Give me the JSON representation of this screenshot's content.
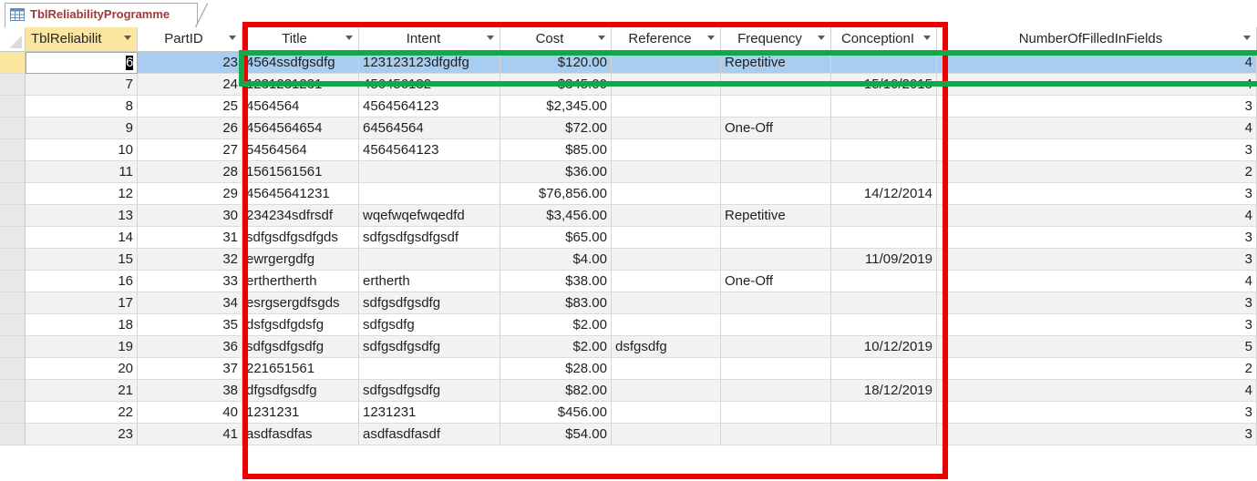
{
  "tab": {
    "title": "TblReliabilityProgramme",
    "icon": "table-icon"
  },
  "columns": [
    {
      "label": "TblReliabilit",
      "align": "right"
    },
    {
      "label": "PartID",
      "align": "right"
    },
    {
      "label": "Title",
      "align": "left"
    },
    {
      "label": "Intent",
      "align": "left"
    },
    {
      "label": "Cost",
      "align": "right"
    },
    {
      "label": "Reference",
      "align": "left"
    },
    {
      "label": "Frequency",
      "align": "left"
    },
    {
      "label": "ConceptionI",
      "align": "right"
    },
    {
      "label": "NumberOfFilledInFields",
      "align": "right"
    }
  ],
  "rows": [
    [
      "6",
      "23",
      "4564ssdfgsdfg",
      "123123123dfgdfg",
      "$120.00",
      "",
      "Repetitive",
      "",
      "4"
    ],
    [
      "7",
      "24",
      "1231231231",
      "456456132",
      "$345.00",
      "",
      "",
      "15/10/2015",
      "4"
    ],
    [
      "8",
      "25",
      "4564564",
      "4564564123",
      "$2,345.00",
      "",
      "",
      "",
      "3"
    ],
    [
      "9",
      "26",
      "4564564654",
      "64564564",
      "$72.00",
      "",
      "One-Off",
      "",
      "4"
    ],
    [
      "10",
      "27",
      "54564564",
      "4564564123",
      "$85.00",
      "",
      "",
      "",
      "3"
    ],
    [
      "11",
      "28",
      "1561561561",
      "",
      "$36.00",
      "",
      "",
      "",
      "2"
    ],
    [
      "12",
      "29",
      "45645641231",
      "",
      "$76,856.00",
      "",
      "",
      "14/12/2014",
      "3"
    ],
    [
      "13",
      "30",
      "234234sdfrsdf",
      "wqefwqefwqedfd",
      "$3,456.00",
      "",
      "Repetitive",
      "",
      "4"
    ],
    [
      "14",
      "31",
      "sdfgsdfgsdfgds",
      "sdfgsdfgsdfgsdf",
      "$65.00",
      "",
      "",
      "",
      "3"
    ],
    [
      "15",
      "32",
      "ewrgergdfg",
      "",
      "$4.00",
      "",
      "",
      "11/09/2019",
      "3"
    ],
    [
      "16",
      "33",
      "erthertherth",
      "ertherth",
      "$38.00",
      "",
      "One-Off",
      "",
      "4"
    ],
    [
      "17",
      "34",
      "esrgsergdfsgds",
      "sdfgsdfgsdfg",
      "$83.00",
      "",
      "",
      "",
      "3"
    ],
    [
      "18",
      "35",
      "dsfgsdfgdsfg",
      "sdfgsdfg",
      "$2.00",
      "",
      "",
      "",
      "3"
    ],
    [
      "19",
      "36",
      "sdfgsdfgsdfg",
      "sdfgsdfgsdfg",
      "$2.00",
      "dsfgsdfg",
      "",
      "10/12/2019",
      "5"
    ],
    [
      "20",
      "37",
      "221651561",
      "",
      "$28.00",
      "",
      "",
      "",
      "2"
    ],
    [
      "21",
      "38",
      "dfgsdfgsdfg",
      "sdfgsdfgsdfg",
      "$82.00",
      "",
      "",
      "18/12/2019",
      "4"
    ],
    [
      "22",
      "40",
      "1231231",
      "1231231",
      "$456.00",
      "",
      "",
      "",
      "3"
    ],
    [
      "23",
      "41",
      "asdfasdfas",
      "asdfasdfasdf",
      "$54.00",
      "",
      "",
      "",
      "3"
    ]
  ],
  "selected_row_index": 0,
  "colors": {
    "highlight_red": "#ee0000",
    "highlight_green": "#10a84a",
    "selected_row": "#a9cdf0",
    "active_header": "#fbe6a0",
    "tab_text": "#a4373a"
  }
}
